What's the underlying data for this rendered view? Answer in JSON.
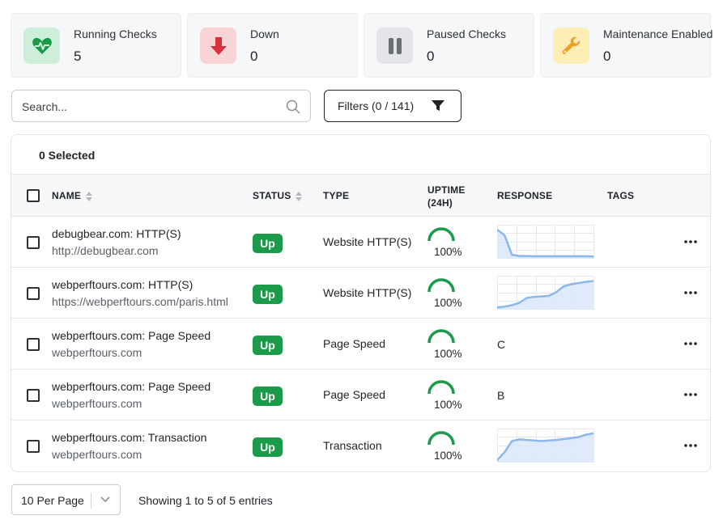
{
  "stats": [
    {
      "label": "Running Checks",
      "value": "5",
      "icon": "heart-pulse-icon",
      "bg": "#cdeed9",
      "fg": "#1a9b4a"
    },
    {
      "label": "Down",
      "value": "0",
      "icon": "arrow-down-icon",
      "bg": "#f9d4d7",
      "fg": "#d8303f"
    },
    {
      "label": "Paused Checks",
      "value": "0",
      "icon": "pause-icon",
      "bg": "#e3e5e8",
      "fg": "#6a6f76"
    },
    {
      "label": "Maintenance Enabled",
      "value": "0",
      "icon": "wrench-icon",
      "bg": "#fdeeb5",
      "fg": "#f0a020"
    }
  ],
  "search": {
    "placeholder": "Search..."
  },
  "filters": {
    "label": "Filters (0 / 141)"
  },
  "table": {
    "selected": "0 Selected",
    "headers": {
      "name": "NAME",
      "status": "STATUS",
      "type": "TYPE",
      "uptime_line1": "UPTIME",
      "uptime_line2": "(24H)",
      "response": "RESPONSE",
      "tags": "TAGS"
    },
    "rows": [
      {
        "name": "debugbear.com: HTTP(S)",
        "sub": "http://debugbear.com",
        "status": "Up",
        "type": "Website HTTP(S)",
        "uptime": "100%",
        "response_text": "",
        "response_series": [
          0.95,
          0.75,
          0.08,
          0.04,
          0.04,
          0.03,
          0.03,
          0.03,
          0.03,
          0.03,
          0.03,
          0.03,
          0.03,
          0.02
        ]
      },
      {
        "name": "webperftours.com: HTTP(S)",
        "sub": "https://webperftours.com/paris.html",
        "status": "Up",
        "type": "Website HTTP(S)",
        "uptime": "100%",
        "response_text": "",
        "response_series": [
          0.02,
          0.05,
          0.1,
          0.18,
          0.35,
          0.38,
          0.4,
          0.42,
          0.55,
          0.75,
          0.82,
          0.86,
          0.9,
          0.93
        ]
      },
      {
        "name": "webperftours.com: Page Speed",
        "sub": "webperftours.com",
        "status": "Up",
        "type": "Page Speed",
        "uptime": "100%",
        "response_text": "C",
        "response_series": []
      },
      {
        "name": "webperftours.com: Page Speed",
        "sub": "webperftours.com",
        "status": "Up",
        "type": "Page Speed",
        "uptime": "100%",
        "response_text": "B",
        "response_series": []
      },
      {
        "name": "webperftours.com: Transaction",
        "sub": "webperftours.com",
        "status": "Up",
        "type": "Transaction",
        "uptime": "100%",
        "response_text": "",
        "response_series": [
          0.02,
          0.3,
          0.68,
          0.74,
          0.72,
          0.7,
          0.68,
          0.7,
          0.72,
          0.75,
          0.78,
          0.82,
          0.9,
          0.95
        ]
      }
    ]
  },
  "footer": {
    "per_page": "10 Per Page",
    "showing": "Showing 1 to 5 of 5 entries"
  },
  "colors": {
    "up": "#1a9b4a",
    "gauge": "#1a9b4a",
    "spark_line": "#8bb8ea",
    "spark_fill": "#d9e8fa"
  }
}
